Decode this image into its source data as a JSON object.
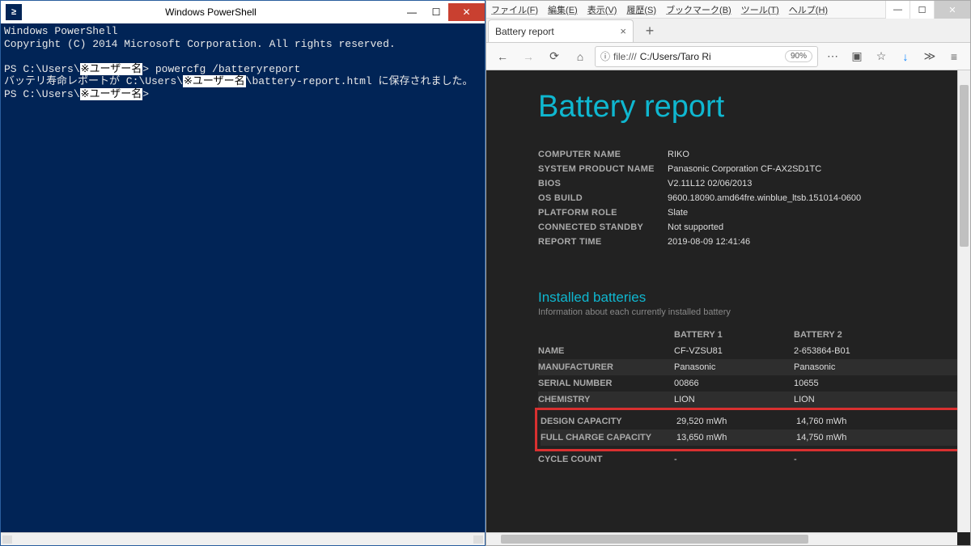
{
  "powershell": {
    "title": "Windows PowerShell",
    "body": {
      "l1": "Windows PowerShell",
      "l2": "Copyright (C) 2014 Microsoft Corporation. All rights reserved.",
      "prompt_prefix": "PS C:\\Users\\",
      "redact": "※ユーザー名",
      "prompt_suffix": "> ",
      "cmd": "powercfg /batteryreport",
      "out_prefix": "バッテリ寿命レポートが C:\\Users\\",
      "out_suffix": "\\battery-report.html に保存されました。"
    }
  },
  "browser": {
    "menu": {
      "file": "ファイル(F)",
      "edit": "編集(E)",
      "view": "表示(V)",
      "history": "履歴(S)",
      "bookmarks": "ブックマーク(B)",
      "tools": "ツール(T)",
      "help": "ヘルプ(H)"
    },
    "tab_title": "Battery report",
    "url_scheme": "file:///",
    "url_rest": "C:/Users/Taro Ri",
    "zoom": "90%"
  },
  "report": {
    "title": "Battery report",
    "info": {
      "computer_name": {
        "label": "COMPUTER NAME",
        "value": "RIKO"
      },
      "product": {
        "label": "SYSTEM PRODUCT NAME",
        "value": "Panasonic Corporation CF-AX2SD1TC"
      },
      "bios": {
        "label": "BIOS",
        "value": "V2.11L12 02/06/2013"
      },
      "os_build": {
        "label": "OS BUILD",
        "value": "9600.18090.amd64fre.winblue_ltsb.151014-0600"
      },
      "platform": {
        "label": "PLATFORM ROLE",
        "value": "Slate"
      },
      "standby": {
        "label": "CONNECTED STANDBY",
        "value": "Not supported"
      },
      "report_time": {
        "label": "REPORT TIME",
        "value": "2019-08-09  12:41:46"
      }
    },
    "batteries": {
      "section_title": "Installed batteries",
      "section_sub": "Information about each currently installed battery",
      "col1": "BATTERY 1",
      "col2": "BATTERY 2",
      "rows": {
        "name": {
          "label": "NAME",
          "b1": "CF-VZSU81",
          "b2": "2-653864-B01"
        },
        "mfr": {
          "label": "MANUFACTURER",
          "b1": "Panasonic",
          "b2": "Panasonic"
        },
        "serial": {
          "label": "SERIAL NUMBER",
          "b1": "00866",
          "b2": "10655"
        },
        "chem": {
          "label": "CHEMISTRY",
          "b1": "LION",
          "b2": "LION"
        },
        "design": {
          "label": "DESIGN CAPACITY",
          "b1": "29,520 mWh",
          "b2": "14,760 mWh"
        },
        "full": {
          "label": "FULL CHARGE CAPACITY",
          "b1": "13,650 mWh",
          "b2": "14,750 mWh"
        },
        "cycle": {
          "label": "CYCLE COUNT",
          "b1": "-",
          "b2": "-"
        }
      }
    }
  }
}
